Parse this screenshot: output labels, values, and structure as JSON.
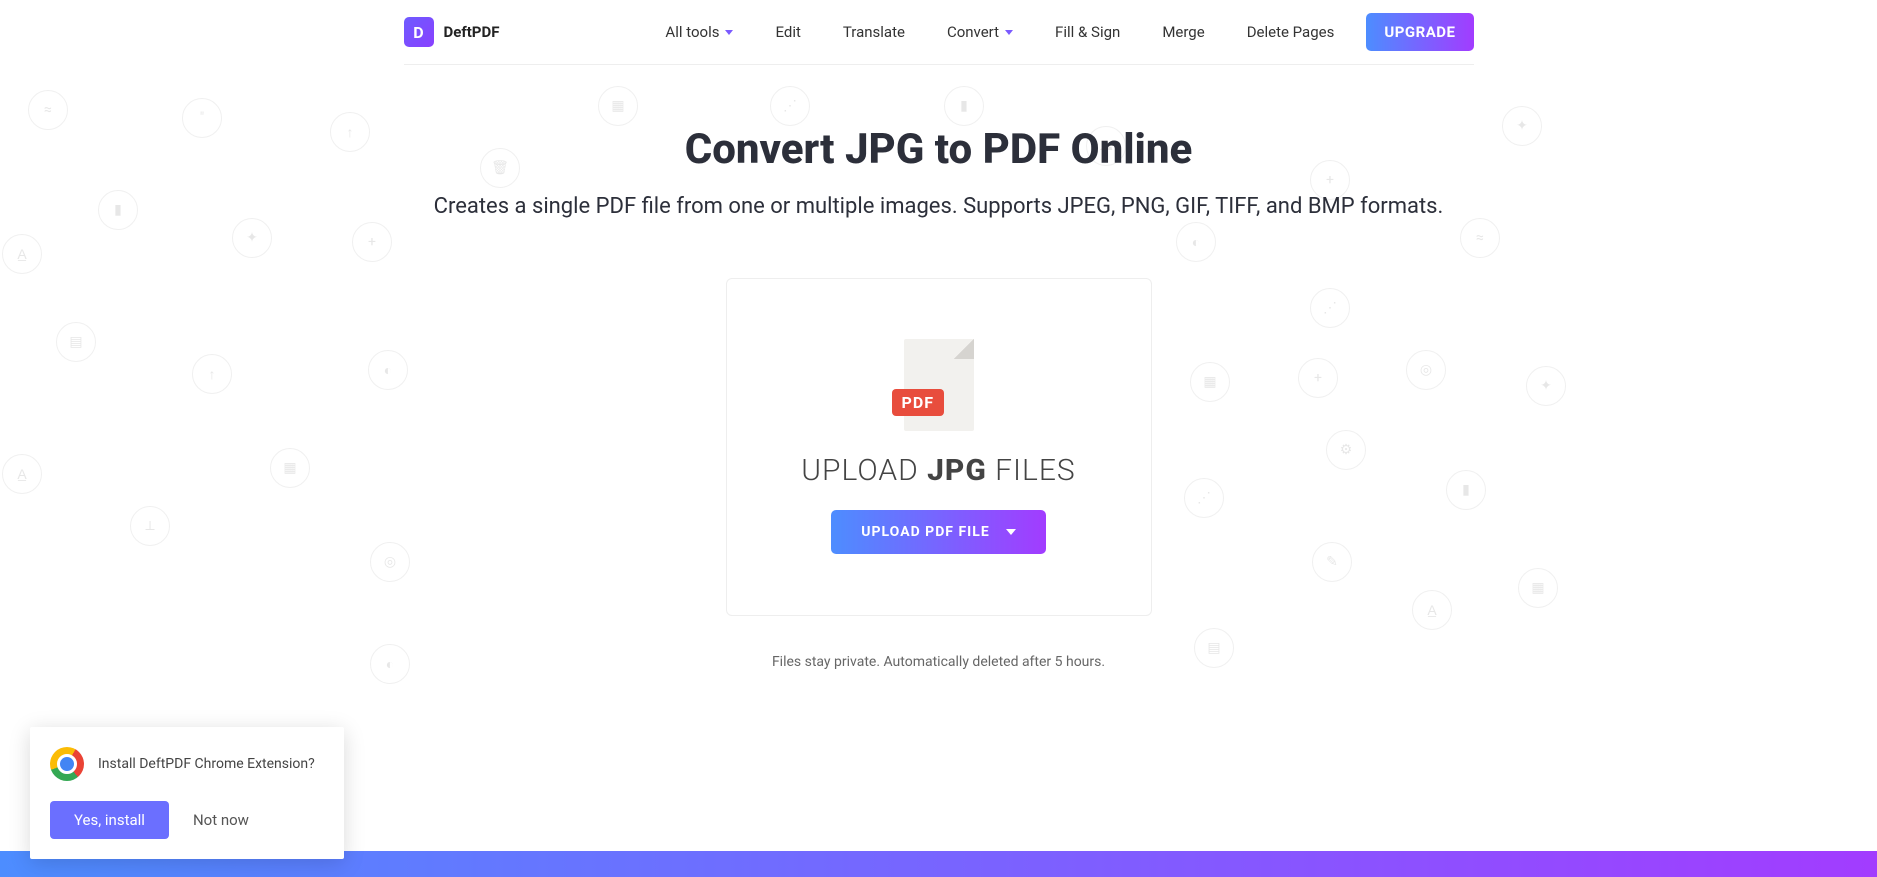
{
  "brand": {
    "letter": "D",
    "name": "DeftPDF"
  },
  "nav": {
    "all_tools": "All tools",
    "edit": "Edit",
    "translate": "Translate",
    "convert": "Convert",
    "fill_sign": "Fill & Sign",
    "merge": "Merge",
    "delete_pages": "Delete Pages",
    "upgrade": "UPGRADE"
  },
  "hero": {
    "title": "Convert JPG to PDF Online",
    "subtitle": "Creates a single PDF file from one or multiple images. Supports JPEG, PNG, GIF, TIFF, and BMP formats."
  },
  "card": {
    "badge": "PDF",
    "upload_prefix": "UPLOAD ",
    "upload_bold": "JPG",
    "upload_suffix": " FILES",
    "button": "UPLOAD PDF FILE"
  },
  "privacy": "Files stay private. Automatically deleted after 5 hours.",
  "popup": {
    "text": "Install DeftPDF Chrome Extension?",
    "yes": "Yes, install",
    "no": "Not now"
  }
}
